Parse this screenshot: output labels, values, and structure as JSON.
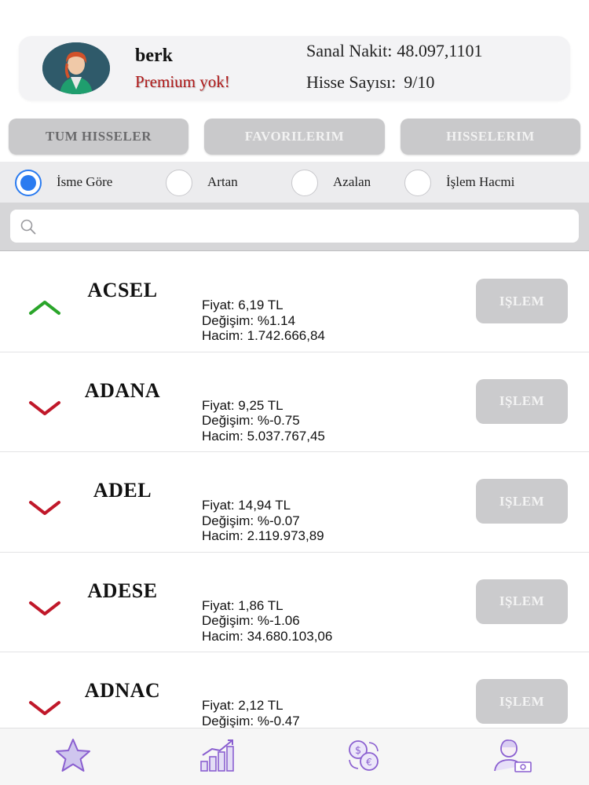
{
  "profile": {
    "username": "berk",
    "premium_status": "Premium yok!",
    "cash_label": "Sanal Nakit:",
    "cash_value": "48.097,1101",
    "shares_label": "Hisse Sayısı:",
    "shares_value": "9/10"
  },
  "tabs": [
    {
      "label": "TUM HISSELER",
      "active": true
    },
    {
      "label": "FAVORILERIM",
      "active": false
    },
    {
      "label": "HISSELERIM",
      "active": false
    }
  ],
  "sort_options": [
    {
      "label": "İsme Göre",
      "selected": true
    },
    {
      "label": "Artan",
      "selected": false
    },
    {
      "label": "Azalan",
      "selected": false
    },
    {
      "label": "İşlem Hacmi",
      "selected": false
    }
  ],
  "search": {
    "placeholder": "",
    "value": ""
  },
  "colors": {
    "up": "#2aa52a",
    "down": "#c0182a",
    "radio_selected": "#2a7bf0",
    "premium": "#b01818"
  },
  "stocks": [
    {
      "symbol": "ACSEL",
      "trend": "up",
      "price": "Fiyat: 6,19 TL",
      "change": "Değişim: %1.14",
      "volume": "Hacim: 1.742.666,84",
      "action": "IŞLEM"
    },
    {
      "symbol": "ADANA",
      "trend": "down",
      "price": "Fiyat: 9,25 TL",
      "change": "Değişim: %-0.75",
      "volume": "Hacim: 5.037.767,45",
      "action": "IŞLEM"
    },
    {
      "symbol": "ADEL",
      "trend": "down",
      "price": "Fiyat: 14,94 TL",
      "change": "Değişim: %-0.07",
      "volume": "Hacim: 2.119.973,89",
      "action": "IŞLEM"
    },
    {
      "symbol": "ADESE",
      "trend": "down",
      "price": "Fiyat: 1,86 TL",
      "change": "Değişim: %-1.06",
      "volume": "Hacim: 34.680.103,06",
      "action": "IŞLEM"
    },
    {
      "symbol": "ADNAC",
      "trend": "down",
      "price": "Fiyat: 2,12 TL",
      "change": "Değişim: %-0.47",
      "volume": "",
      "action": "IŞLEM"
    }
  ],
  "bottom_nav": [
    {
      "icon": "star-icon"
    },
    {
      "icon": "bar-chart-icon"
    },
    {
      "icon": "currency-exchange-icon"
    },
    {
      "icon": "user-money-icon"
    }
  ]
}
